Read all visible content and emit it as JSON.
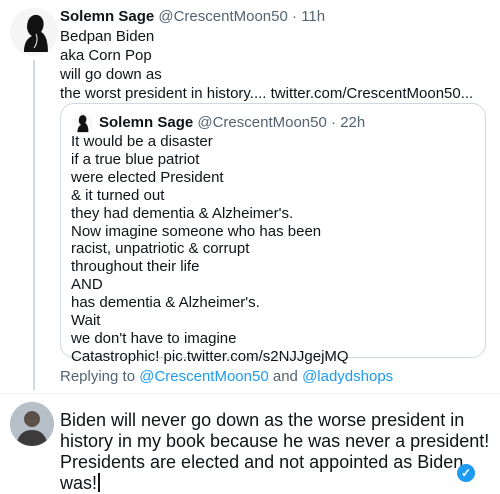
{
  "main_tweet": {
    "author_name": "Solemn Sage",
    "handle": "@CrescentMoon50",
    "time": "11h",
    "body": "Bedpan Biden\naka Corn Pop\nwill go down as\nthe worst president in history.... twitter.com/CrescentMoon50..."
  },
  "quoted_tweet": {
    "author_name": "Solemn Sage",
    "handle": "@CrescentMoon50",
    "time": "22h",
    "body": "It would be a disaster\nif a true blue patriot\nwere elected President\n& it turned out\nthey had dementia & Alzheimer's.\nNow imagine someone who has been\nracist, unpatriotic & corrupt\nthroughout their life\nAND\nhas dementia & Alzheimer's.\nWait\nwe don't have to imagine\nCatastrophic! pic.twitter.com/s2NJJgejMQ"
  },
  "replying": {
    "prefix": "Replying to",
    "user1": "@CrescentMoon50",
    "conjunction": "and",
    "user2": "@ladydshops"
  },
  "reply_composer": {
    "text": "Biden will never go down as the worse president in history in my book because he was never a president! Presidents are elected and not appointed as Biden was!",
    "badge": "✓"
  },
  "separators": {
    "dot": "·"
  },
  "colors": {
    "accent": "#1d9bf0",
    "muted": "#536471"
  }
}
